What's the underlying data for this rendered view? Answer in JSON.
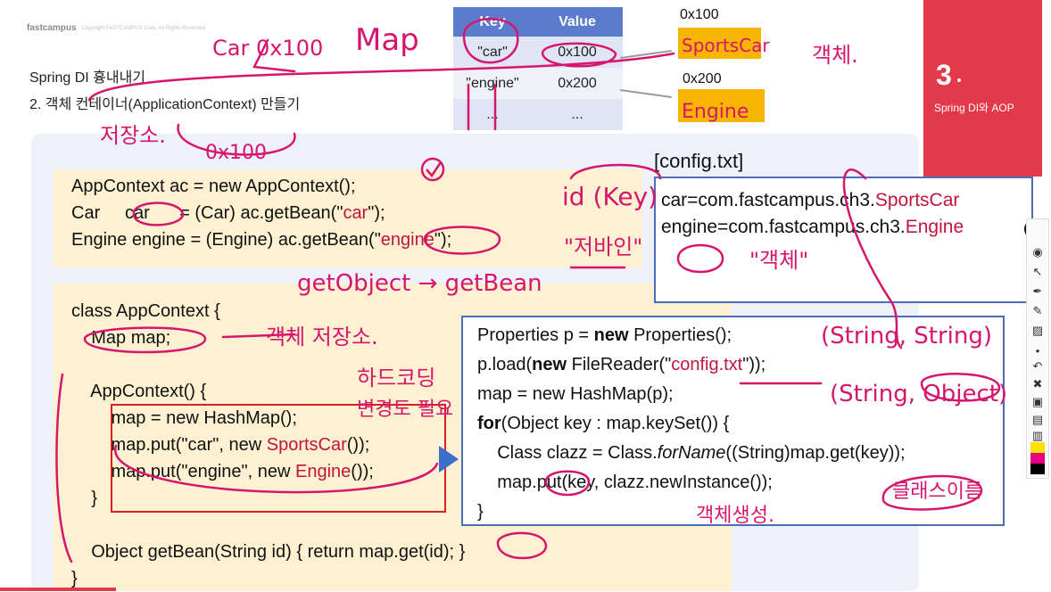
{
  "brand": {
    "name": "fastcampus",
    "copyright": "Copyright FASTCAMPUS Corp. All Rights Reserved"
  },
  "header": {
    "line1": "Spring DI 흉내내기",
    "line2": "2. 객체 컨테이너(ApplicationContext) 만들기"
  },
  "chapter": {
    "number": "3",
    "title": "Spring DI와 AOP"
  },
  "map_table": {
    "headers": [
      "Key",
      "Value"
    ],
    "rows": [
      [
        "\"car\"",
        "0x100"
      ],
      [
        "\"engine\"",
        "0x200"
      ],
      [
        "...",
        "..."
      ]
    ]
  },
  "objects": [
    {
      "address": "0x100"
    },
    {
      "address": "0x200"
    }
  ],
  "code_top": {
    "lines": [
      [
        "AppContext ac = new AppContext();"
      ],
      [
        "Car     car      = (Car) ac.getBean(\"",
        "car",
        "\");"
      ],
      [
        "Engine engine = (Engine) ac.getBean(\"",
        "engine",
        "\");"
      ]
    ]
  },
  "code_class": {
    "lines": [
      "class AppContext {",
      "    Map map;",
      "",
      "    AppContext() {",
      "        map = new HashMap();",
      [
        "        map.put(\"car\", new ",
        "SportsCar",
        "());"
      ],
      [
        "        map.put(\"engine\", new ",
        "Engine",
        "());"
      ],
      "    }",
      "",
      "    Object getBean(String id) { return map.get(id); }",
      "}"
    ]
  },
  "config": {
    "title": "[config.txt]",
    "lines": [
      [
        "car=com.fastcampus.ch3.",
        "SportsCar"
      ],
      [
        "engine=com.fastcampus.ch3.",
        "Engine"
      ]
    ]
  },
  "props_code": {
    "line1": [
      "Properties p = ",
      "new",
      " Properties();"
    ],
    "line2": [
      "p.load(",
      "new",
      " FileReader(\"",
      "config.txt",
      "\"));"
    ],
    "line3": "map = new HashMap(p);",
    "line4": [
      "for",
      "(Object key : map.keySet()) {"
    ],
    "line5": [
      "    Class clazz = Class.",
      "forName",
      "((String)map.get(key));"
    ],
    "line6": "    map.put(key, clazz.newInstance());",
    "line7": "}"
  },
  "annotations": {
    "car_addr": "Car 0x100",
    "map": "Map",
    "object": "객체.",
    "sportscar_note": "SportsCar",
    "engine_note": "Engine",
    "storage": "저장소.",
    "addr": "0x100",
    "id_key": "id (Key)",
    "handle": "\"저바인\"",
    "getobject": "getObject → getBean",
    "object_quote": "\"객체\"",
    "obj_storage": "객체 저장소.",
    "hardcoding": "하드코딩",
    "change_needed": "변경도 필요",
    "string_string": "(String, String)",
    "string_object": "(String, Object)",
    "class_name": "클래스이름",
    "obj_create": "객체생성."
  },
  "colors": {
    "ink": "#d6166e",
    "chapter": "#e23a4b",
    "table_header": "#5b7ccc",
    "object_box": "#f7b500",
    "code_bg": "#fdf1d2",
    "panel_bg": "#eef1fa"
  }
}
